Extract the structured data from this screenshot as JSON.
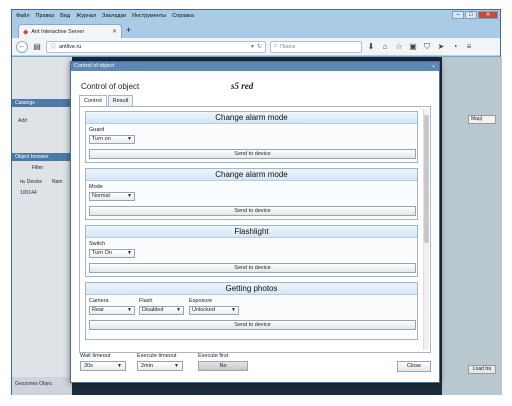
{
  "browser": {
    "menu": [
      "Файл",
      "Правка",
      "Вид",
      "Журнал",
      "Закладки",
      "Инструменты",
      "Справка"
    ],
    "tab_title": "Ant Interactive Server",
    "url": "antlive.ru",
    "search_placeholder": "Поиск"
  },
  "app": {
    "catalogs": "Catalogs",
    "add": "Add",
    "object_browser": "Object browser",
    "filter": "Filter",
    "col_no": "№ Device",
    "col_name": "Nam",
    "row_device": "100144",
    "row_name": "s5 r",
    "map_dropdown": "Map)",
    "map_button": "Load tra",
    "bottom_tabs": "Geozones  Objec"
  },
  "dialog": {
    "window_title": "Control of object",
    "header": "Control of object",
    "object_name": "s5 red",
    "tabs": [
      "Control",
      "Result"
    ],
    "sections": [
      {
        "title": "Change alarm mode",
        "fields": [
          {
            "label": "Guard",
            "value": "Turn on"
          }
        ],
        "button": "Send to device"
      },
      {
        "title": "Change alarm mode",
        "fields": [
          {
            "label": "Mode",
            "value": "Normal"
          }
        ],
        "button": "Send to device"
      },
      {
        "title": "Flashlight",
        "fields": [
          {
            "label": "Switch",
            "value": "Turn On"
          }
        ],
        "button": "Send to device"
      },
      {
        "title": "Getting photos",
        "fields": [
          {
            "label": "Camera",
            "value": "Rear"
          },
          {
            "label": "Flash",
            "value": "Disabled"
          },
          {
            "label": "Exposure",
            "value": "Unlocked"
          }
        ],
        "button": "Send to device"
      }
    ],
    "footer": {
      "wait_label": "Wait timeout",
      "wait_value": "30s",
      "exec_label": "Execute timeout",
      "exec_value": "2min",
      "first_label": "Execute first",
      "first_value": "No",
      "close": "Close"
    }
  }
}
